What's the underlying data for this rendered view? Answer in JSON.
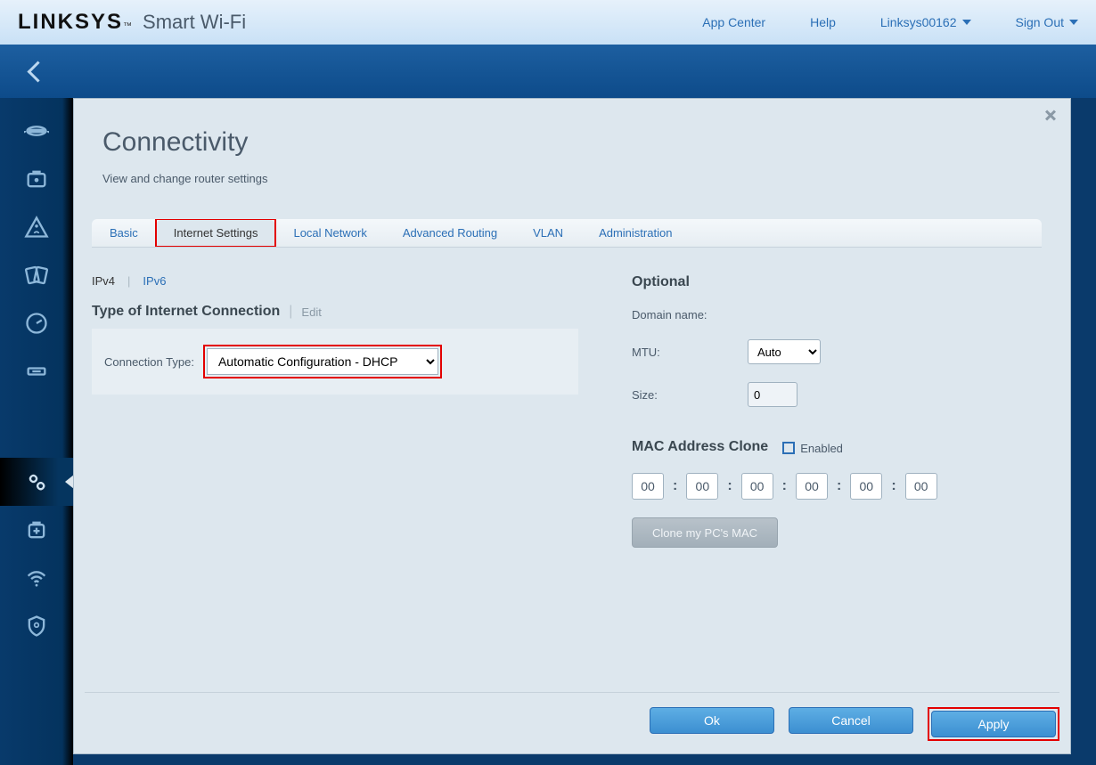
{
  "brand": {
    "logo": "LINKSYS",
    "sub": "Smart Wi-Fi"
  },
  "topnav": {
    "appcenter": "App Center",
    "help": "Help",
    "device": "Linksys00162",
    "signout": "Sign Out"
  },
  "panel": {
    "title": "Connectivity",
    "subtitle": "View and change router settings"
  },
  "tabs": {
    "basic": "Basic",
    "internet": "Internet Settings",
    "localnet": "Local Network",
    "advrouting": "Advanced Routing",
    "vlan": "VLAN",
    "admin": "Administration"
  },
  "subtabs": {
    "ipv4": "IPv4",
    "ipv6": "IPv6"
  },
  "left": {
    "section": "Type of Internet Connection",
    "edit": "Edit",
    "ctype_label": "Connection Type:",
    "ctype_value": "Automatic Configuration - DHCP"
  },
  "right": {
    "section": "Optional",
    "domain_label": "Domain name:",
    "mtu_label": "MTU:",
    "mtu_value": "Auto",
    "size_label": "Size:",
    "size_value": "0",
    "mac_section": "MAC Address Clone",
    "enabled_label": "Enabled",
    "mac": [
      "00",
      "00",
      "00",
      "00",
      "00",
      "00"
    ],
    "clone_btn": "Clone my PC's MAC"
  },
  "footer": {
    "ok": "Ok",
    "cancel": "Cancel",
    "apply": "Apply"
  }
}
